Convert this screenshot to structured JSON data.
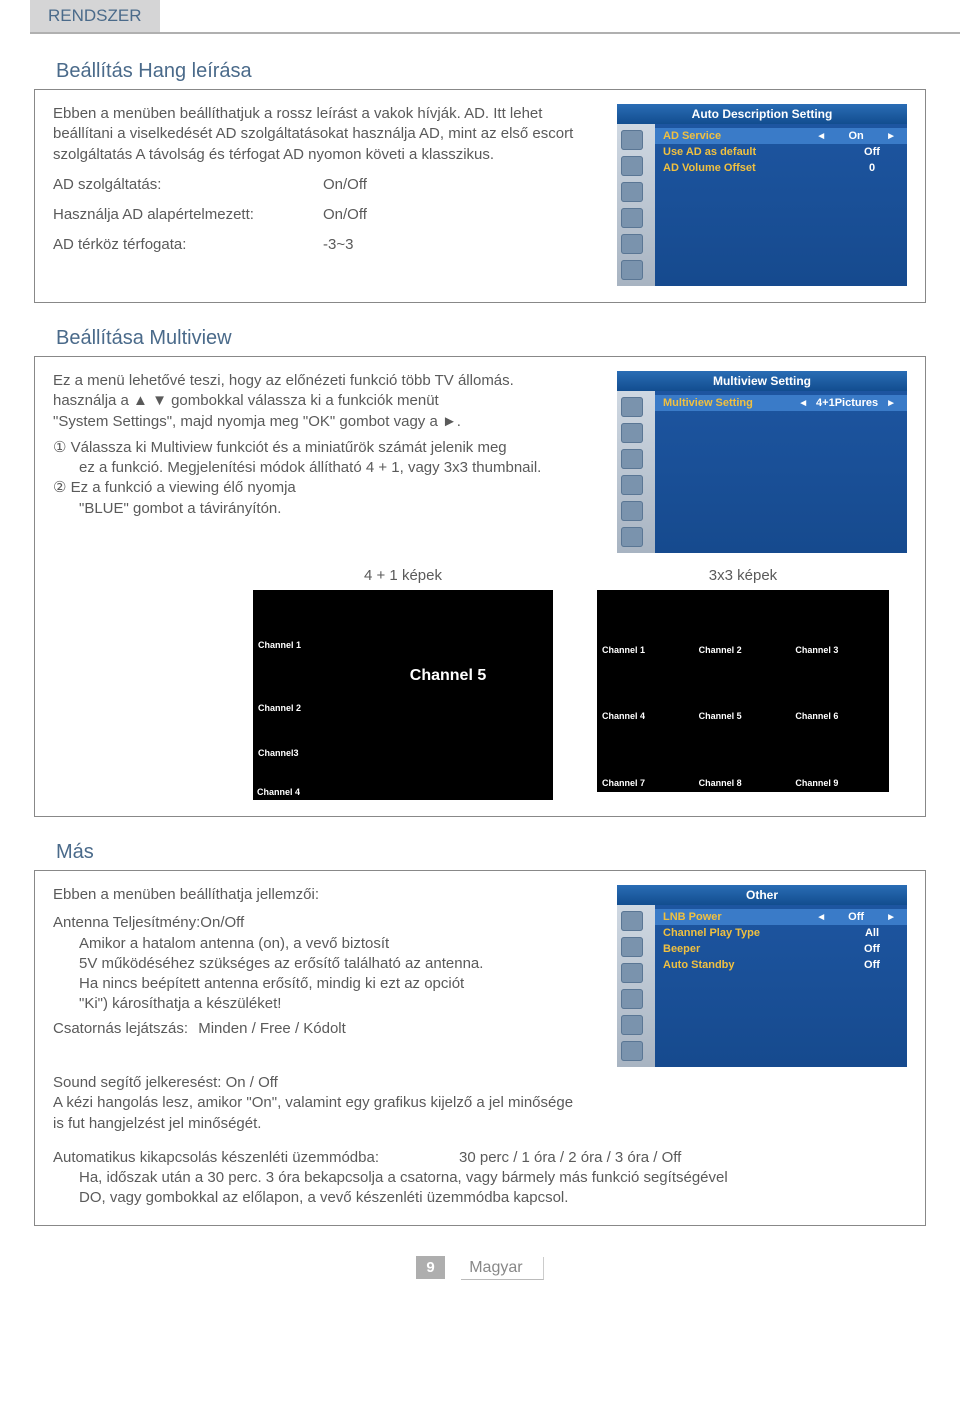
{
  "header": {
    "title": "RENDSZER"
  },
  "section1": {
    "title": "Beállítás Hang leírása",
    "intro": "Ebben a menüben beállíthatjuk a rossz leírást a vakok hívják. AD. Itt lehet beállítani a viselkedését AD szolgáltatásokat használja AD, mint az első escort szolgáltatás A távolság és térfogat AD nyomon követi a klasszikus.",
    "rows": [
      {
        "label": "AD szolgáltatás:",
        "value": "On/Off"
      },
      {
        "label": "Használja AD alapértelmezett:",
        "value": "On/Off"
      },
      {
        "label": "AD térköz térfogata:",
        "value": "-3~3"
      }
    ],
    "osd": {
      "title": "Auto Description Setting",
      "items": [
        {
          "label": "AD Service",
          "value": "On",
          "highlight": true
        },
        {
          "label": "Use AD as default",
          "value": "Off"
        },
        {
          "label": "AD Volume Offset",
          "value": "0"
        }
      ]
    }
  },
  "section2": {
    "title": "Beállítása Multiview",
    "line1": "Ez a menü lehetővé teszi, hogy az előnézeti funkció több TV állomás.",
    "line2_a": "használja a ▲ ▼ gombokkal válassza ki a funkciók menüt",
    "line2_b": "\"System Settings\", majd nyomja meg \"OK\" gombot vagy a ►.",
    "num1": "①",
    "num1_text_a": "Válassza ki Multiview funkciót és a miniatűrök számát jelenik meg",
    "num1_text_b": "ez a funkció. Megjelenítési módok állítható 4 + 1, vagy 3x3 thumbnail.",
    "num2": "②",
    "num2_text_a": "Ez a funkció a viewing élő nyomja",
    "num2_text_b": "\"BLUE\" gombot a távirányítón.",
    "osd": {
      "title": "Multiview Setting",
      "items": [
        {
          "label": "Multiview Setting",
          "value": "4+1Pictures",
          "highlight": true
        }
      ]
    },
    "diagram1": {
      "title": "4 + 1 képek",
      "cells": {
        "c1": "Channel 1",
        "c2": "Channel 2",
        "c3": "Channel3",
        "c4": "Channel 4",
        "main": "Channel 5"
      }
    },
    "diagram2": {
      "title": "3x3 képek",
      "cells": [
        "Channel 1",
        "Channel 2",
        "Channel 3",
        "Channel 4",
        "Channel 5",
        "Channel 6",
        "Channel 7",
        "Channel 8",
        "Channel 9"
      ]
    }
  },
  "section3": {
    "title": "Más",
    "intro": "Ebben a menüben beállíthatja jellemzői:",
    "antenna_label": "Antenna Teljesítmény:On/Off",
    "antenna_p1": "Amikor a hatalom antenna (on), a vevő biztosít",
    "antenna_p2": "5V működéséhez szükséges az erősítő található az antenna.",
    "antenna_p3": "Ha nincs beépített antenna erősítő, mindig ki ezt az opciót",
    "antenna_p4": "\"Ki\") károsíthatja a készüléket!",
    "csatorna_label": "Csatornás lejátszás:",
    "csatorna_value": "Minden / Free / Kódolt",
    "sound_label": "Sound segítő jelkeresést: On / Off",
    "sound_p1": "A kézi hangolás lesz, amikor \"On\", valamint egy grafikus kijelző a jel minősége",
    "sound_p2": "is fut hangjelzést jel minőségét.",
    "auto_label": "Automatikus kikapcsolás készenléti üzemmódba:",
    "auto_value": "30 perc / 1 óra / 2 óra / 3 óra / Off",
    "auto_p1": "Ha, időszak után a 30 perc. 3 óra bekapcsolja a csatorna, vagy bármely más funkció segítségével",
    "auto_p2": "DO, vagy gombokkal az előlapon, a vevő készenléti üzemmódba kapcsol.",
    "osd": {
      "title": "Other",
      "items": [
        {
          "label": "LNB Power",
          "value": "Off",
          "highlight": true
        },
        {
          "label": "Channel Play Type",
          "value": "All"
        },
        {
          "label": "Beeper",
          "value": "Off"
        },
        {
          "label": "Auto Standby",
          "value": "Off"
        }
      ]
    }
  },
  "footer": {
    "page": "9",
    "lang": "Magyar"
  }
}
